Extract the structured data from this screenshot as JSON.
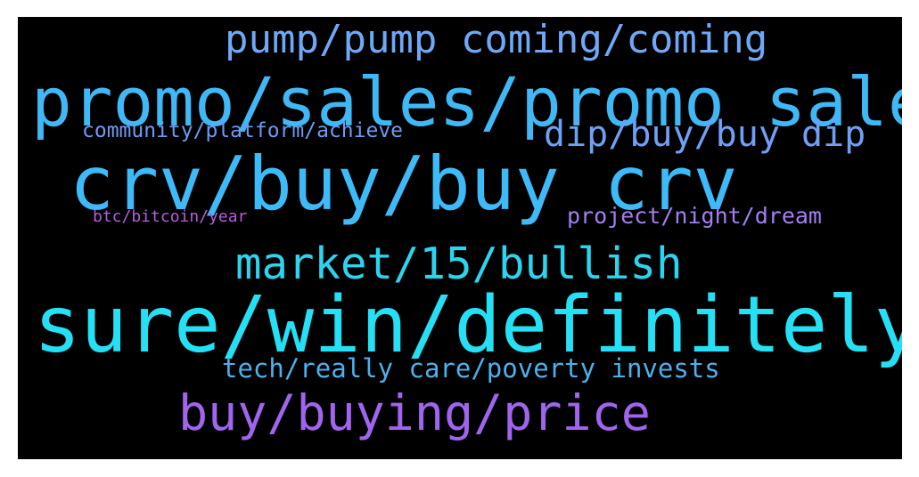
{
  "wordcloud": {
    "background": "#000000",
    "words": [
      {
        "text": "pump/pump coming/coming",
        "color": "#6ea8f7"
      },
      {
        "text": "promo/sales/promo sales",
        "color": "#40b8f5"
      },
      {
        "text": "community/platform/achieve",
        "color": "#6f9af4"
      },
      {
        "text": "dip/buy/buy dip",
        "color": "#6fa0f6"
      },
      {
        "text": "crv/buy/buy crv",
        "color": "#3ebaf8"
      },
      {
        "text": "btc/bitcoin/year",
        "color": "#b65de0"
      },
      {
        "text": "project/night/dream",
        "color": "#a37ef2"
      },
      {
        "text": "market/15/bullish",
        "color": "#2bd5ef"
      },
      {
        "text": "sure/win/definitely",
        "color": "#25e0f4"
      },
      {
        "text": "tech/really care/poverty invests",
        "color": "#4ab2ec"
      },
      {
        "text": "buy/buying/price",
        "color": "#9f65ee"
      }
    ]
  }
}
